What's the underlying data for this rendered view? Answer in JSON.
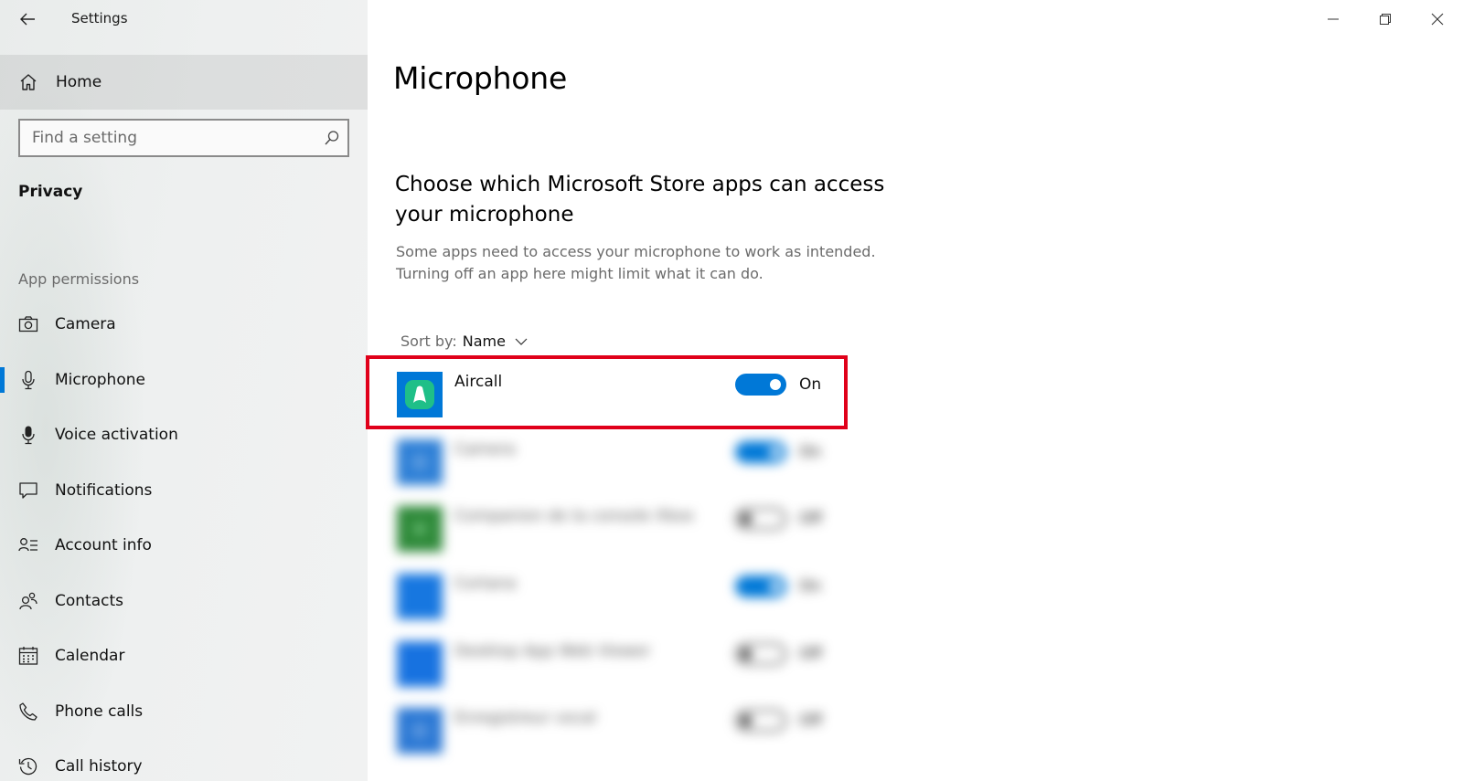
{
  "window": {
    "title": "Settings"
  },
  "sidebar": {
    "home_label": "Home",
    "search_placeholder": "Find a setting",
    "section_title": "Privacy",
    "group_title": "App permissions",
    "items": [
      {
        "label": "Camera",
        "icon": "camera-icon"
      },
      {
        "label": "Microphone",
        "icon": "microphone-icon",
        "active": true
      },
      {
        "label": "Voice activation",
        "icon": "voice-activation-icon"
      },
      {
        "label": "Notifications",
        "icon": "notifications-icon"
      },
      {
        "label": "Account info",
        "icon": "account-info-icon"
      },
      {
        "label": "Contacts",
        "icon": "contacts-icon"
      },
      {
        "label": "Calendar",
        "icon": "calendar-icon"
      },
      {
        "label": "Phone calls",
        "icon": "phone-icon"
      },
      {
        "label": "Call history",
        "icon": "history-icon"
      }
    ]
  },
  "main": {
    "page_title": "Microphone",
    "section_title": "Choose which Microsoft Store apps can access your microphone",
    "section_desc": "Some apps need to access your microphone to work as intended. Turning off an app here might limit what it can do.",
    "sort_label": "Sort by:",
    "sort_value": "Name",
    "apps": [
      {
        "name": "Aircall",
        "state": "On",
        "enabled": true,
        "icon_color": "#0078d7",
        "blurred": false
      },
      {
        "name": "Camera",
        "state": "On",
        "enabled": true,
        "icon_color": "#2d7fd6",
        "blurred": true
      },
      {
        "name": "Companion de la console Xbox",
        "state": "Off",
        "enabled": false,
        "icon_color": "#2f8a3a",
        "blurred": true
      },
      {
        "name": "Cortana",
        "state": "On",
        "enabled": true,
        "icon_color": "#1777e0",
        "blurred": true
      },
      {
        "name": "Desktop App Web Viewer",
        "state": "Off",
        "enabled": false,
        "icon_color": "#1772e0",
        "blurred": true
      },
      {
        "name": "Enregistreur vocal",
        "state": "Off",
        "enabled": false,
        "icon_color": "#2b78d4",
        "blurred": true
      }
    ]
  },
  "colors": {
    "accent": "#0078d7",
    "highlight": "#e0001a",
    "aircall_green": "#1fbf88"
  }
}
